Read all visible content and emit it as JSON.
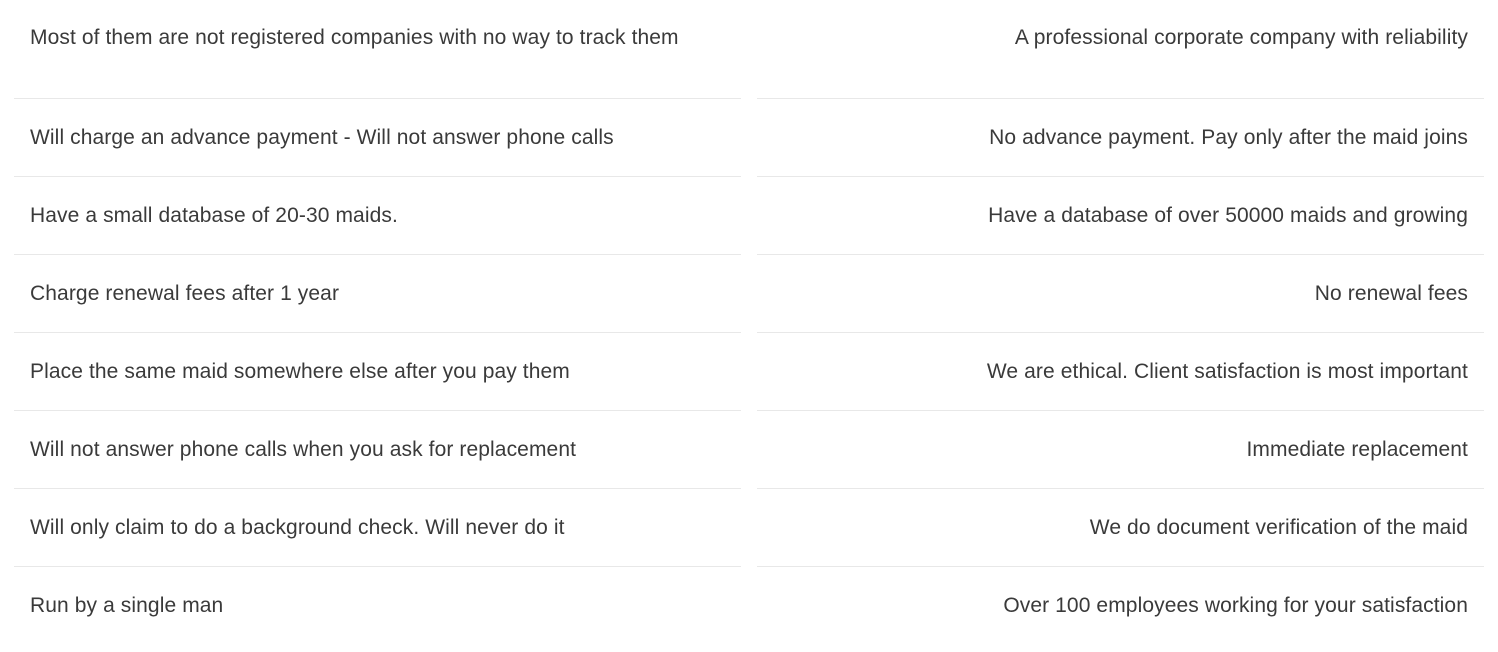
{
  "comparison": {
    "others": [
      "Most of them are not registered companies with no way to track them",
      "Will charge an advance payment - Will not answer phone calls",
      "Have a small database of 20-30 maids.",
      "Charge renewal fees after 1 year",
      "Place the same maid somewhere else after you pay them",
      "Will not answer phone calls when you ask for replacement",
      "Will only claim to do a background check. Will never do it",
      "Run by a single man"
    ],
    "us": [
      "A professional corporate company with reliability",
      "No advance payment. Pay only after the maid joins",
      "Have a database of over 50000 maids and growing",
      "No renewal fees",
      "We are ethical. Client satisfaction is most important",
      "Immediate replacement",
      "We do document verification of the maid",
      "Over 100 employees working for your satisfaction"
    ]
  }
}
